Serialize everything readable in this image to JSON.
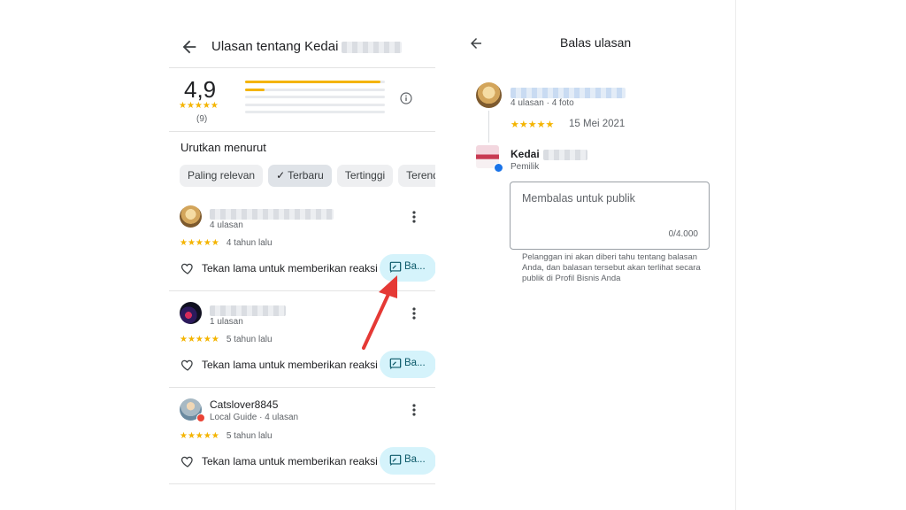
{
  "left_panel": {
    "header": {
      "title": "Ulasan tentang Kedai",
      "back_icon": "arrow-left-icon"
    },
    "summary": {
      "rating": "4,9",
      "stars": "★★★★★",
      "count": "(9)",
      "distribution": [
        0.97,
        0.14,
        0,
        0,
        0
      ]
    },
    "sort_label": "Urutkan menurut",
    "chips": [
      {
        "label": "Paling relevan",
        "selected": false
      },
      {
        "label": "Terbaru",
        "selected": true,
        "check": "✓"
      },
      {
        "label": "Tertinggi",
        "selected": false
      },
      {
        "label": "Terendah",
        "selected": false
      }
    ],
    "reviews": [
      {
        "name": "",
        "meta": "4 ulasan",
        "stars": "★★★★★",
        "time": "4 tahun lalu",
        "react": "Tekan lama untuk memberikan reaksi",
        "reply": "Ba..."
      },
      {
        "name": "",
        "meta": "1 ulasan",
        "stars": "★★★★★",
        "time": "5 tahun lalu",
        "react": "Tekan lama untuk memberikan reaksi",
        "reply": "Ba..."
      },
      {
        "name": "Catslover8845",
        "meta": "Local Guide · 4 ulasan",
        "stars": "★★★★★",
        "time": "5 tahun lalu",
        "react": "Tekan lama untuk memberikan reaksi",
        "reply": "Ba..."
      }
    ]
  },
  "right_panel": {
    "header": {
      "title": "Balas ulasan",
      "back_icon": "arrow-left-icon"
    },
    "review": {
      "meta": "4 ulasan · 4 foto",
      "stars": "★★★★★",
      "date": "15 Mei 2021"
    },
    "owner": {
      "name": "Kedai",
      "role": "Pemilik"
    },
    "reply_field": {
      "placeholder": "Membalas untuk publik",
      "counter": "0/4.000"
    },
    "note": "Pelanggan ini akan diberi tahu tentang balasan Anda, dan balasan tersebut akan terlihat secara publik di Profil Bisnis Anda"
  },
  "colors": {
    "star": "#f4b400",
    "reply_button": "#d5f3fb",
    "arrow": "#e53935"
  }
}
